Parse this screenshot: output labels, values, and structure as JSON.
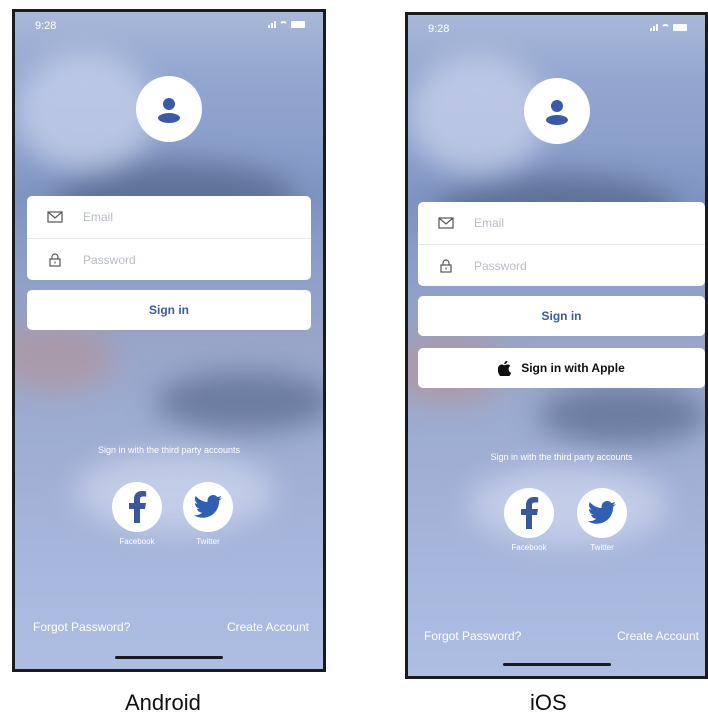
{
  "android": {
    "status_time": "9:28",
    "email_placeholder": "Email",
    "password_placeholder": "Password",
    "sign_in_label": "Sign in",
    "third_party_label": "Sign in with the third party accounts",
    "facebook_label": "Facebook",
    "twitter_label": "Twitter",
    "forgot_password_label": "Forgot Password?",
    "create_account_label": "Create Account",
    "caption": "Android"
  },
  "ios": {
    "status_time": "9:28",
    "email_placeholder": "Email",
    "password_placeholder": "Password",
    "sign_in_label": "Sign in",
    "apple_sign_in_label": "Sign in with Apple",
    "third_party_label": "Sign in with the third party accounts",
    "facebook_label": "Facebook",
    "twitter_label": "Twitter",
    "forgot_password_label": "Forgot Password?",
    "create_account_label": "Create Account",
    "caption": "iOS"
  },
  "icons": {
    "user": "user-icon",
    "email": "mail-icon",
    "password": "lock-icon",
    "apple": "apple-icon",
    "facebook": "facebook-icon",
    "twitter": "twitter-icon"
  },
  "colors": {
    "accent": "#3a5aa8",
    "facebook": "#3b5998",
    "twitter": "#2f5fb0",
    "screen_bg": "#93a6cf"
  }
}
